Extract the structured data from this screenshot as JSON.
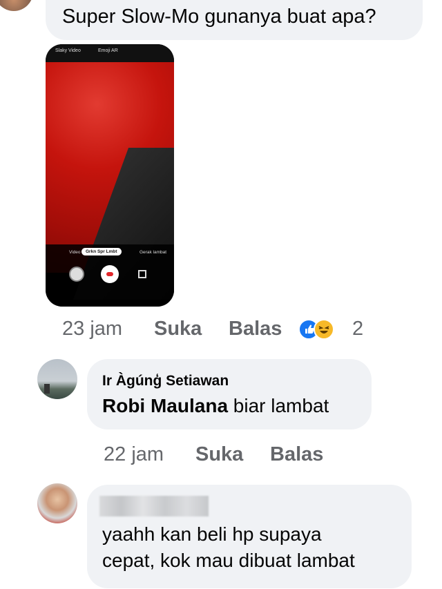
{
  "comment1": {
    "text": "Super Slow-Mo gunanya buat apa?",
    "media": {
      "top_labels": [
        "Slaky Video",
        "Emoji AR"
      ],
      "modes": [
        "Video",
        "Grkn Spr Lmbt",
        "Gerak lambat"
      ]
    },
    "time": "23 jam",
    "like_label": "Suka",
    "reply_label": "Balas",
    "reactions": [
      "like-icon",
      "haha-icon"
    ],
    "reaction_count": "2"
  },
  "comment2": {
    "author": "Ir Àgúnģ Setiawan",
    "mention": "Robi Maulana",
    "text": "biar lambat",
    "time": "22 jam",
    "like_label": "Suka",
    "reply_label": "Balas"
  },
  "comment3": {
    "text_line1": "yaahh kan beli hp supaya",
    "text_line2": "cepat, kok mau dibuat lambat"
  },
  "colors": {
    "bubble": "#f0f2f5",
    "meta_text": "#65676b",
    "like_blue": "#1877f2",
    "haha_yellow": "#f7b928"
  }
}
